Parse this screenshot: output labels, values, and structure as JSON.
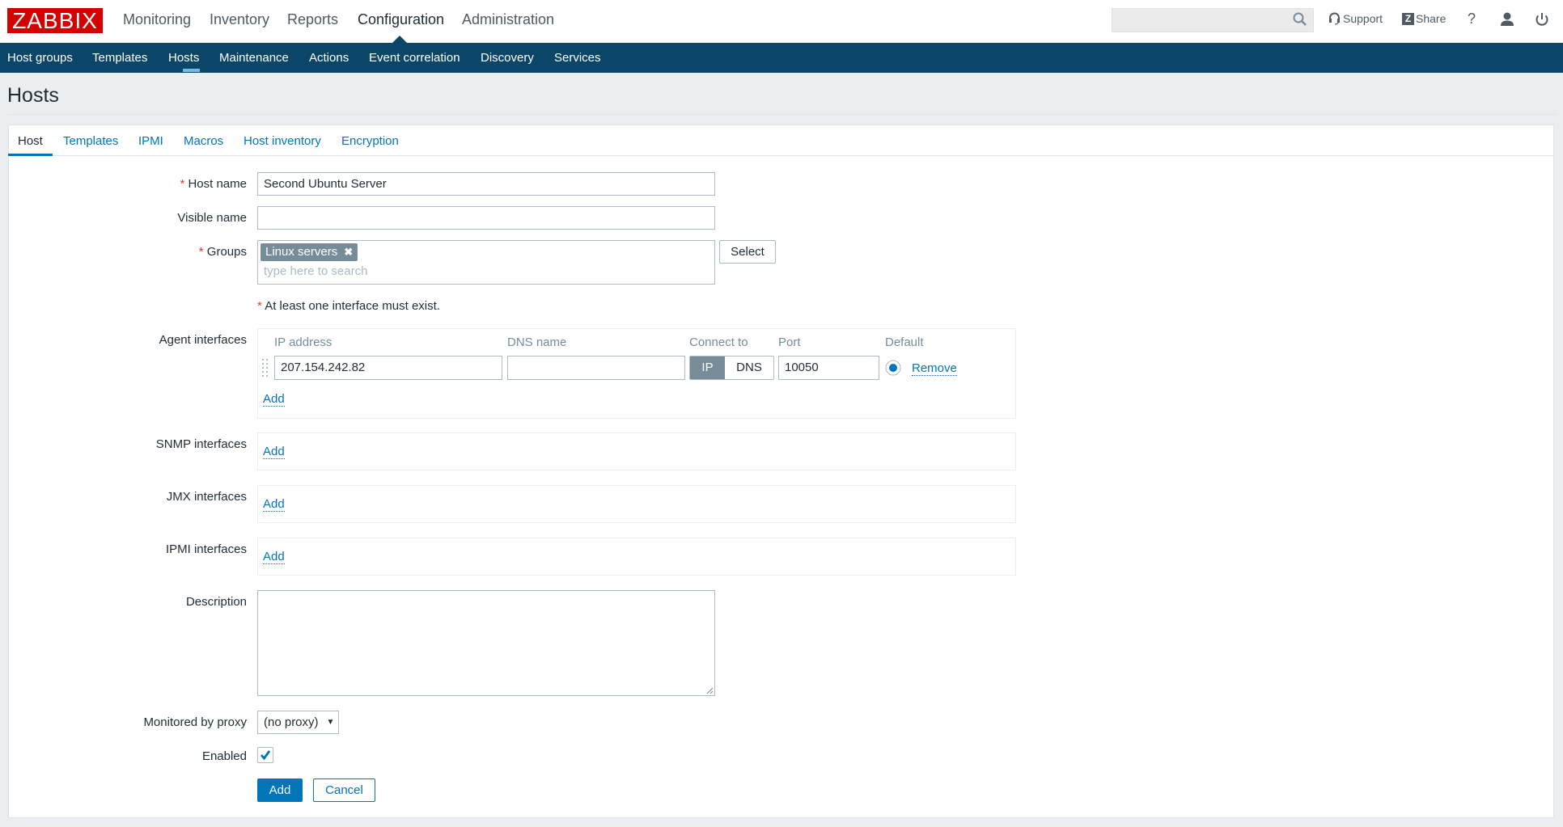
{
  "header": {
    "logo": "ZABBIX",
    "main_menu": [
      "Monitoring",
      "Inventory",
      "Reports",
      "Configuration",
      "Administration"
    ],
    "active_menu": "Configuration",
    "search": {
      "value": "",
      "placeholder": ""
    },
    "support_label": "Support",
    "share_label": "Share",
    "share_badge": "Z",
    "help_label": "?"
  },
  "sub_nav": {
    "items": [
      "Host groups",
      "Templates",
      "Hosts",
      "Maintenance",
      "Actions",
      "Event correlation",
      "Discovery",
      "Services"
    ],
    "active": "Hosts"
  },
  "page": {
    "title": "Hosts",
    "tabs": [
      "Host",
      "Templates",
      "IPMI",
      "Macros",
      "Host inventory",
      "Encryption"
    ],
    "active_tab": "Host"
  },
  "form": {
    "host_name": {
      "label": "Host name",
      "value": "Second Ubuntu Server",
      "required": "*"
    },
    "visible_name": {
      "label": "Visible name",
      "value": ""
    },
    "groups": {
      "label": "Groups",
      "required": "*",
      "selected": [
        "Linux servers"
      ],
      "remove_glyph": "✖",
      "placeholder": "type here to search",
      "select_button": "Select"
    },
    "interface_warning": {
      "asterisk": "*",
      "text": "At least one interface must exist."
    },
    "agent_interfaces": {
      "label": "Agent interfaces",
      "columns": [
        "IP address",
        "DNS name",
        "Connect to",
        "Port",
        "Default"
      ],
      "rows": [
        {
          "ip": "207.154.242.82",
          "dns": "",
          "connect_options": [
            "IP",
            "DNS"
          ],
          "connect_selected": "IP",
          "port": "10050",
          "default": true,
          "remove_label": "Remove"
        }
      ],
      "add_label": "Add"
    },
    "snmp_interfaces": {
      "label": "SNMP interfaces",
      "add_label": "Add"
    },
    "jmx_interfaces": {
      "label": "JMX interfaces",
      "add_label": "Add"
    },
    "ipmi_interfaces": {
      "label": "IPMI interfaces",
      "add_label": "Add"
    },
    "description": {
      "label": "Description",
      "value": ""
    },
    "proxy": {
      "label": "Monitored by proxy",
      "selected": "(no proxy)"
    },
    "enabled": {
      "label": "Enabled",
      "checked": true
    },
    "buttons": {
      "add": "Add",
      "cancel": "Cancel"
    }
  },
  "colors": {
    "brand_red": "#d40000",
    "nav_bg": "#0b4668",
    "accent_blue": "#0275b8",
    "tag_bg": "#768d99",
    "required": "#e33734"
  }
}
